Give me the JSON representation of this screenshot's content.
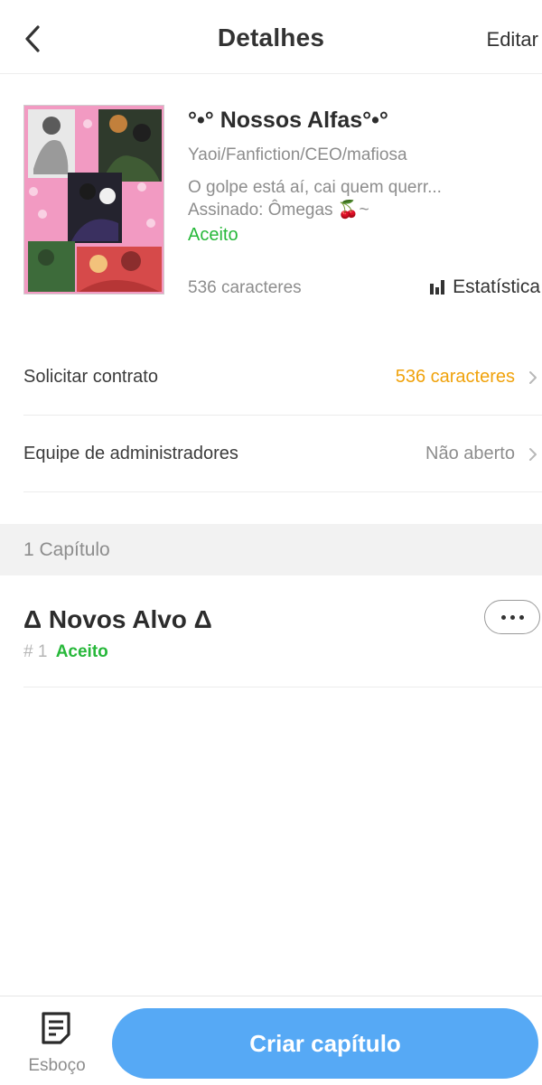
{
  "header": {
    "title": "Detalhes",
    "edit_label": "Editar"
  },
  "story": {
    "title": "°•° Nossos Alfas°•°",
    "tags": "Yaoi/Fanfiction/CEO/mafiosa",
    "description_line1": "O golpe está aí, cai quem querr...",
    "description_line2": "Assinado: Ômegas 🍒~",
    "status": "Aceito",
    "char_count": "536 caracteres",
    "stats_label": "Estatística"
  },
  "rows": [
    {
      "label": "Solicitar contrato",
      "value": "536 caracteres",
      "value_color": "#f0a20b"
    },
    {
      "label": "Equipe de administradores",
      "value": "Não aberto",
      "value_color": "#8d8d8d"
    }
  ],
  "chapters_section": {
    "title": "1 Capítulo"
  },
  "chapters": [
    {
      "title": "Δ Novos Alvo Δ",
      "number": "# 1",
      "status": "Aceito"
    }
  ],
  "bottom": {
    "draft_label": "Esboço",
    "create_label": "Criar capítulo"
  },
  "colors": {
    "accent_blue": "#56a9f5",
    "status_green": "#27b83a",
    "highlight_orange": "#f0a20b"
  }
}
